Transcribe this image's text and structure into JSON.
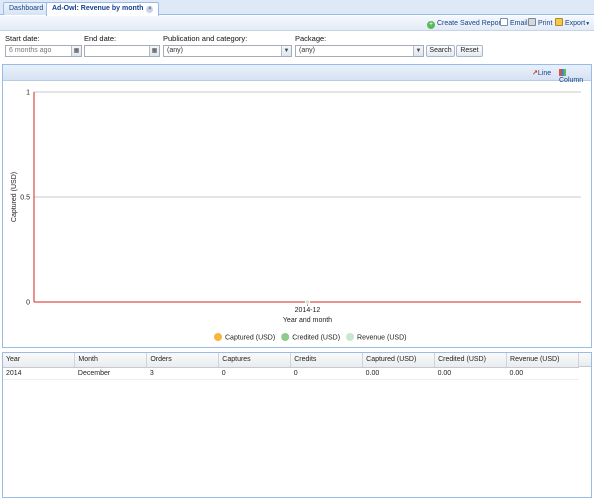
{
  "tabs": [
    {
      "label": "Dashboard",
      "active": false
    },
    {
      "label": "Ad-Owl: Revenue by month",
      "active": true
    }
  ],
  "toolbar": {
    "create_saved_report": "Create Saved Report",
    "email": "Email",
    "print": "Print",
    "export": "Export"
  },
  "filters": {
    "start_date": {
      "label": "Start date:",
      "placeholder": "6 months ago"
    },
    "end_date": {
      "label": "End date:",
      "value": ""
    },
    "publication": {
      "label": "Publication and category:",
      "value": "(any)"
    },
    "package": {
      "label": "Package:",
      "value": "(any)"
    },
    "search_label": "Search",
    "reset_label": "Reset"
  },
  "chart_controls": {
    "line_label": "Line",
    "column_label": "Column"
  },
  "chart_data": {
    "type": "line",
    "x": [
      "2014-12"
    ],
    "series": [
      {
        "name": "Captured (USD)",
        "values": [
          0
        ],
        "color": "#f6b63c"
      },
      {
        "name": "Credited (USD)",
        "values": [
          0
        ],
        "color": "#8fc98c"
      },
      {
        "name": "Revenue (USD)",
        "values": [
          0
        ],
        "color": "#c9e6cf"
      }
    ],
    "xlabel": "Year and month",
    "ylabel": "Captured (USD)",
    "ylim": [
      0,
      1
    ],
    "yticks": [
      "0",
      "0.5",
      "1"
    ],
    "grid": true,
    "legend": "bottom"
  },
  "table": {
    "columns": [
      "Year",
      "Month",
      "Orders",
      "Captures",
      "Credits",
      "Captured (USD)",
      "Credited (USD)",
      "Revenue (USD)"
    ],
    "rows": [
      [
        "2014",
        "December",
        "3",
        "0",
        "0",
        "0.00",
        "0.00",
        "0.00"
      ]
    ]
  },
  "colors": {
    "tab_text": "#15428b",
    "axis_red": "#d9261c",
    "panel_border": "#99bbe8"
  }
}
